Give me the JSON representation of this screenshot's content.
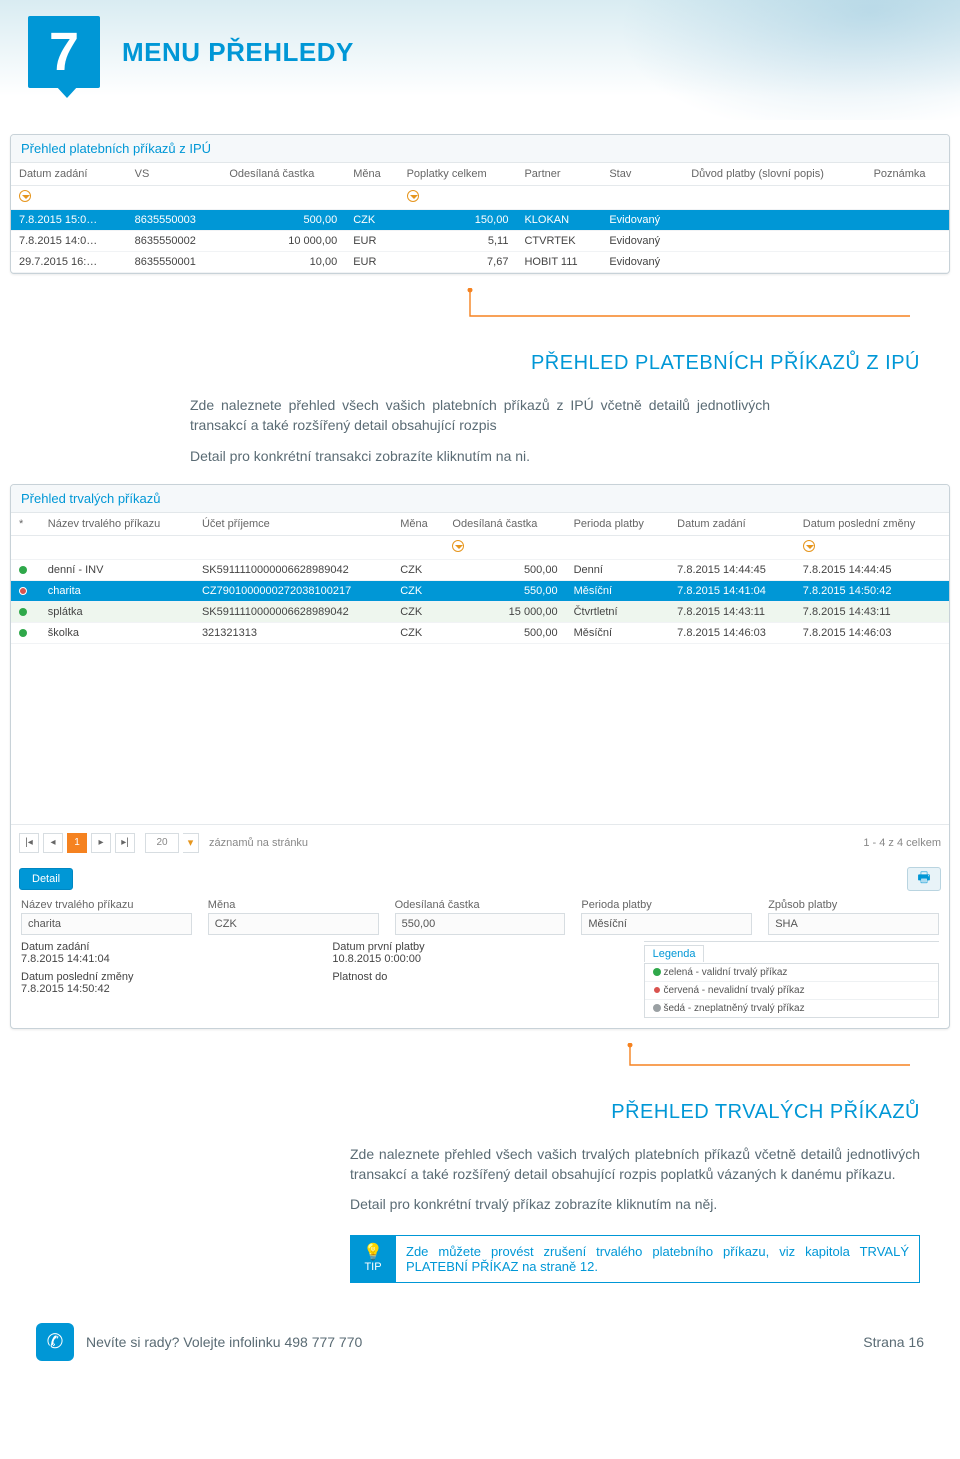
{
  "chapter": {
    "number": "7",
    "title": "MENU PŘEHLEDY"
  },
  "shot1": {
    "title": "Přehled platebních příkazů z IPÚ",
    "headers": [
      "Datum zadání",
      "VS",
      "Odesílaná častka",
      "Měna",
      "Poplatky celkem",
      "Partner",
      "Stav",
      "Důvod platby (slovní popis)",
      "Poznámka"
    ],
    "rows": [
      {
        "sel": true,
        "cells": [
          "7.8.2015 15:0…",
          "8635550003",
          "500,00",
          "CZK",
          "150,00",
          "KLOKAN",
          "Evidovaný",
          "",
          ""
        ]
      },
      {
        "sel": false,
        "cells": [
          "7.8.2015 14:0…",
          "8635550002",
          "10 000,00",
          "EUR",
          "5,11",
          "CTVRTEK",
          "Evidovaný",
          "",
          ""
        ]
      },
      {
        "sel": false,
        "cells": [
          "29.7.2015 16:…",
          "8635550001",
          "10,00",
          "EUR",
          "7,67",
          "HOBIT 111",
          "Evidovaný",
          "",
          ""
        ]
      }
    ]
  },
  "section1": {
    "heading": "PŘEHLED PLATEBNÍCH PŘÍKAZŮ Z IPÚ",
    "p1": "Zde naleznete přehled všech vašich platebních příkazů z IPÚ včetně detailů jednotlivých transakcí a také rozšířený detail obsahující rozpis",
    "p2": "Detail pro konkrétní transakci zobrazíte kliknutím na ni."
  },
  "shot2": {
    "title": "Přehled trvalých příkazů",
    "headers": [
      "*",
      "Název trvalého příkazu",
      "Účet příjemce",
      "Měna",
      "Odesílaná častka",
      "Perioda platby",
      "Datum zadání",
      "Datum poslední změny"
    ],
    "rows": [
      {
        "dot": "green",
        "sel": false,
        "alt": false,
        "cells": [
          "denní - INV",
          "SK5911110000006628989042",
          "CZK",
          "500,00",
          "Denní",
          "7.8.2015 14:44:45",
          "7.8.2015 14:44:45"
        ]
      },
      {
        "dot": "red",
        "sel": true,
        "alt": false,
        "cells": [
          "charita",
          "CZ7901000000272038100217",
          "CZK",
          "550,00",
          "Měsíční",
          "7.8.2015 14:41:04",
          "7.8.2015 14:50:42"
        ]
      },
      {
        "dot": "green",
        "sel": false,
        "alt": true,
        "cells": [
          "splátka",
          "SK5911110000006628989042",
          "CZK",
          "15 000,00",
          "Čtvrtletní",
          "7.8.2015 14:43:11",
          "7.8.2015 14:43:11"
        ]
      },
      {
        "dot": "green",
        "sel": false,
        "alt": false,
        "cells": [
          "školka",
          "321321313",
          "CZK",
          "500,00",
          "Měsíční",
          "7.8.2015 14:46:03",
          "7.8.2015 14:46:03"
        ]
      }
    ],
    "pager": {
      "current": "1",
      "pageSize": "20",
      "perPageLabel": "záznamů na stránku",
      "countLabel": "1 - 4 z 4 celkem"
    },
    "detail": {
      "button": "Detail",
      "fields": {
        "name_lbl": "Název trvalého příkazu",
        "name_val": "charita",
        "currency_lbl": "Měna",
        "currency_val": "CZK",
        "amount_lbl": "Odesílaná častka",
        "amount_val": "550,00",
        "period_lbl": "Perioda platby",
        "period_val": "Měsíční",
        "method_lbl": "Způsob platby",
        "method_val": "SHA",
        "created_lbl": "Datum zadání",
        "created_val": "7.8.2015 14:41:04",
        "first_lbl": "Datum první platby",
        "first_val": "10.8.2015 0:00:00",
        "changed_lbl": "Datum poslední změny",
        "changed_val": "7.8.2015 14:50:42",
        "valid_lbl": "Platnost do",
        "valid_val": ""
      },
      "legend": {
        "title": "Legenda",
        "green": "zelená - validní trvalý příkaz",
        "red": "červená - nevalidní trvalý příkaz",
        "grey": "šedá - zneplatněný trvalý příkaz"
      }
    }
  },
  "section2": {
    "heading": "PŘEHLED TRVALÝCH PŘÍKAZŮ",
    "p1": "Zde naleznete přehled všech vašich trvalých platebních příkazů včetně detailů jednotlivých transakcí a také rozšířený detail obsahující rozpis poplatků vázaných k danému příkazu.",
    "p2": "Detail pro konkrétní trvalý příkaz zobrazíte kliknutím na něj."
  },
  "tip": {
    "label": "TIP",
    "text": "Zde můžete provést zrušení trvalého platebního příkazu, viz kapitola TRVALÝ PLATEBNÍ PŘÍKAZ na straně 12."
  },
  "footer": {
    "help": "Nevíte si rady? Volejte infolinku 498 777 770",
    "page": "Strana 16"
  }
}
